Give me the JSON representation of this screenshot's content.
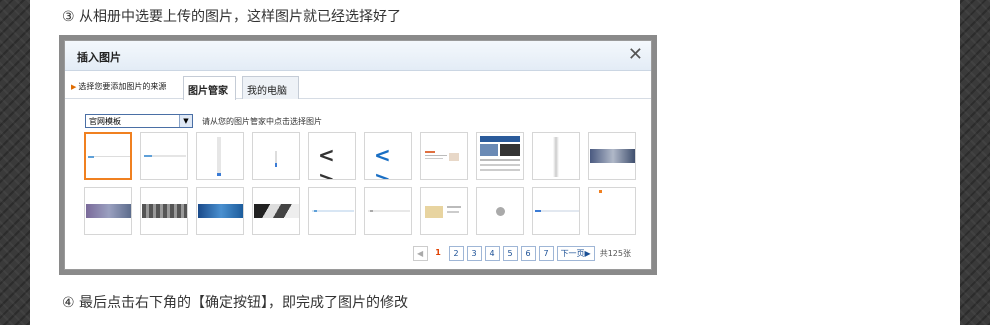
{
  "steps": {
    "step3": "③ 从相册中选要上传的图片，这样图片就已经选择好了",
    "step4": "④ 最后点击右下角的【确定按钮】，即完成了图片的修改"
  },
  "dialog": {
    "title": "插入图片",
    "close_icon": "close-icon",
    "source_label": "选择您要添加图片的来源",
    "tabs": [
      "图片管家",
      "我的电脑"
    ],
    "active_tab": "图片管家",
    "album_select": "官网模板",
    "hint": "请从您的图片管家中点击选择图片",
    "pager": {
      "prev": "◀",
      "pages": [
        "1",
        "2",
        "3",
        "4",
        "5",
        "6",
        "7"
      ],
      "current": "1",
      "next": "下一页▶",
      "total": "共125张"
    }
  },
  "colors": {
    "accent": "#f08020",
    "link": "#1a4f95",
    "current_page": "#e04000"
  }
}
